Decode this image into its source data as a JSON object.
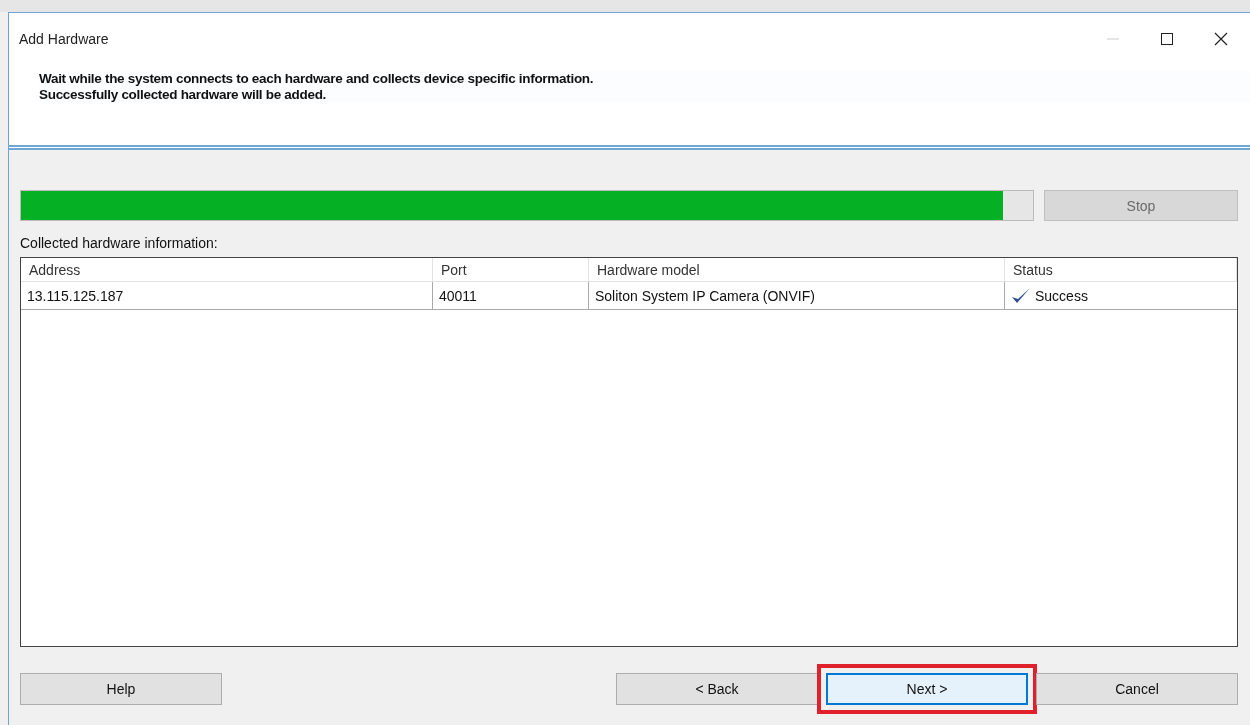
{
  "window": {
    "title": "Add Hardware"
  },
  "header": {
    "lines": [
      "Wait while the system connects to each hardware and collects device specific information.",
      "Successfully collected hardware will be added."
    ]
  },
  "progress": {
    "level": 0.97
  },
  "stop_button": {
    "label": "Stop",
    "disabled": true
  },
  "table_label": "Collected hardware information:",
  "table": {
    "columns": [
      "Address",
      "Port",
      "Hardware model",
      "Status"
    ],
    "rows": [
      {
        "address": "13.115.125.187",
        "port": "40011",
        "model": "Soliton System IP Camera (ONVIF)",
        "status": "Success",
        "success": true
      }
    ]
  },
  "buttons": [
    {
      "label": "Help",
      "kind": "left",
      "highlighted": false,
      "focused": false
    },
    {
      "label": "< Back",
      "kind": "right",
      "highlighted": false,
      "focused": false
    },
    {
      "label": "Next >",
      "kind": "right",
      "highlighted": true,
      "focused": true
    },
    {
      "label": "Cancel",
      "kind": "right",
      "highlighted": false,
      "focused": false
    }
  ]
}
